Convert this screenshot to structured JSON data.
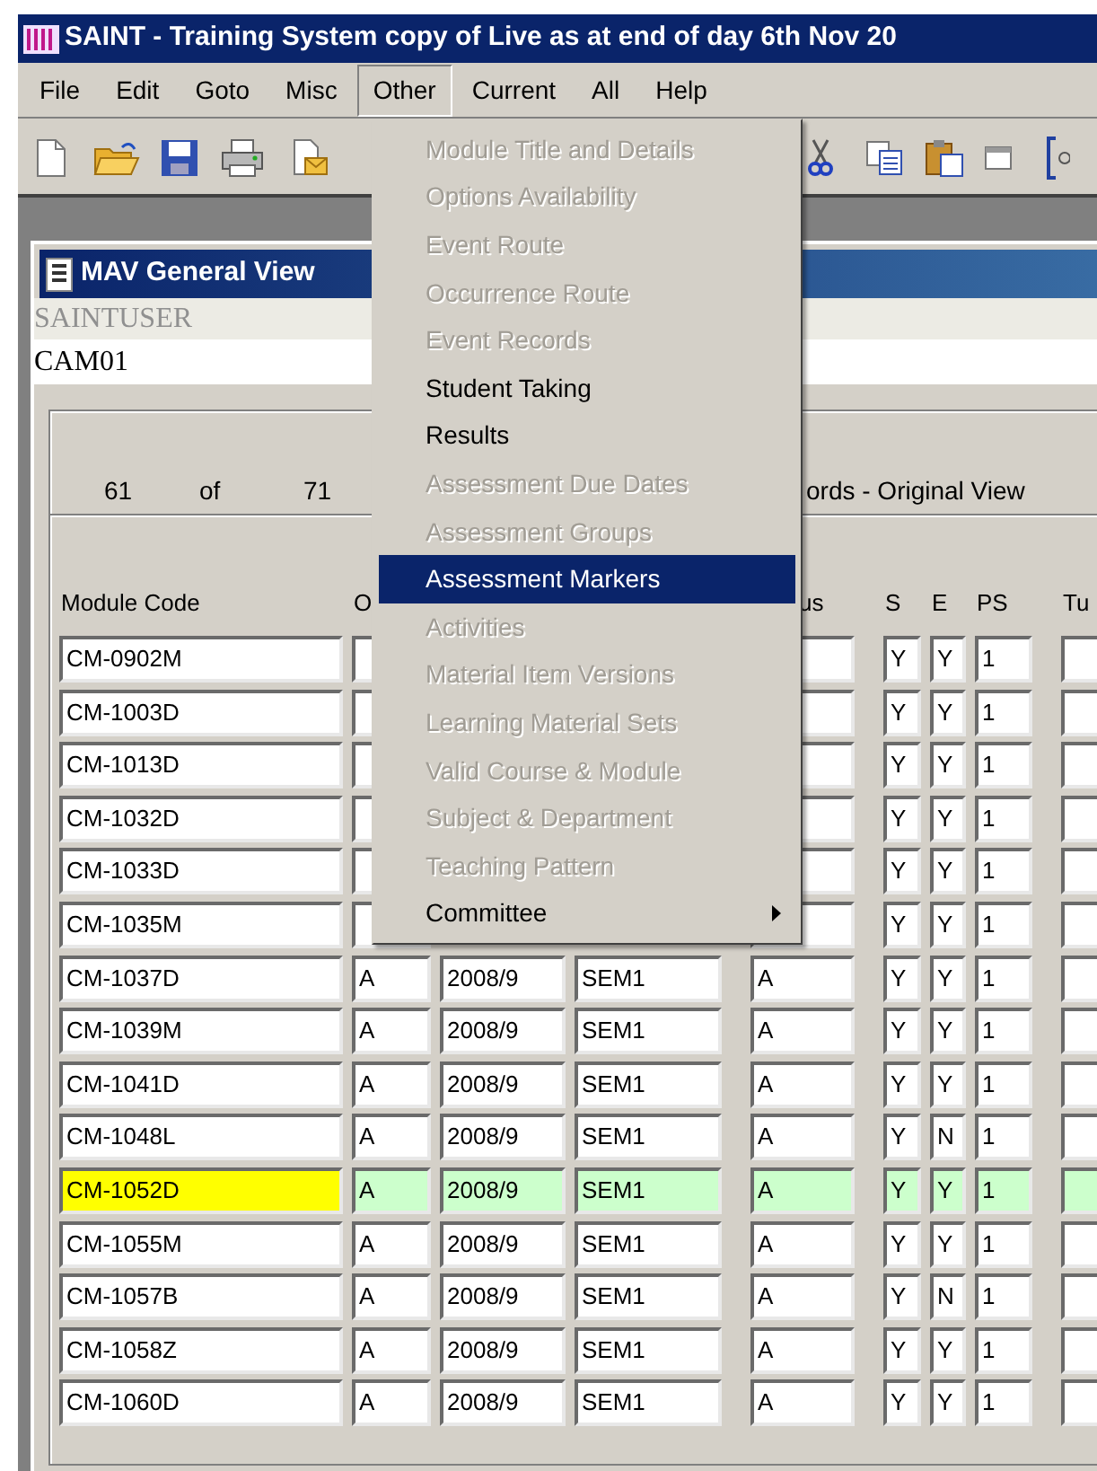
{
  "window": {
    "title": "SAINT - Training System copy of Live as at end of day 6th Nov 20"
  },
  "menu_bar": [
    {
      "label": "File",
      "selected": false
    },
    {
      "label": "Edit",
      "selected": false
    },
    {
      "label": "Goto",
      "selected": false
    },
    {
      "label": "Misc",
      "selected": false
    },
    {
      "label": "Other",
      "selected": true
    },
    {
      "label": "Current",
      "selected": false
    },
    {
      "label": "All",
      "selected": false
    },
    {
      "label": "Help",
      "selected": false
    }
  ],
  "other_menu": {
    "items": [
      {
        "label": "Module Title and Details",
        "disabled": true,
        "selected": false,
        "submenu": false
      },
      {
        "label": "Options Availability",
        "disabled": true,
        "selected": false,
        "submenu": false
      },
      {
        "label": "Event Route",
        "disabled": true,
        "selected": false,
        "submenu": false
      },
      {
        "label": "Occurrence Route",
        "disabled": true,
        "selected": false,
        "submenu": false
      },
      {
        "label": "Event Records",
        "disabled": true,
        "selected": false,
        "submenu": false
      },
      {
        "label": "Student Taking",
        "disabled": false,
        "selected": false,
        "submenu": false
      },
      {
        "label": "Results",
        "disabled": false,
        "selected": false,
        "submenu": false
      },
      {
        "label": "Assessment Due Dates",
        "disabled": true,
        "selected": false,
        "submenu": false
      },
      {
        "label": "Assessment Groups",
        "disabled": true,
        "selected": false,
        "submenu": false
      },
      {
        "label": "Assessment Markers",
        "disabled": false,
        "selected": true,
        "submenu": false
      },
      {
        "label": "Activities",
        "disabled": true,
        "selected": false,
        "submenu": false
      },
      {
        "label": "Material Item Versions",
        "disabled": true,
        "selected": false,
        "submenu": false
      },
      {
        "label": "Learning Material Sets",
        "disabled": true,
        "selected": false,
        "submenu": false
      },
      {
        "label": "Valid Course & Module",
        "disabled": true,
        "selected": false,
        "submenu": false
      },
      {
        "label": "Subject & Department",
        "disabled": true,
        "selected": false,
        "submenu": false
      },
      {
        "label": "Teaching Pattern",
        "disabled": true,
        "selected": false,
        "submenu": false
      },
      {
        "label": "Committee",
        "disabled": false,
        "selected": false,
        "submenu": true
      }
    ]
  },
  "child_window": {
    "title": "MAV General View",
    "user": "SAINTUSER",
    "code": "CAM01"
  },
  "record_counter": {
    "current": "61",
    "of_label": "of",
    "total": "71",
    "view_label": "ords - Original View"
  },
  "table": {
    "columns": [
      "Module Code",
      "O",
      "us",
      "S",
      "E",
      "PS",
      "Tu"
    ],
    "rows": [
      {
        "module_code": "CM-0902M",
        "s": "Y",
        "e": "Y",
        "ps": "1",
        "selected": false
      },
      {
        "module_code": "CM-1003D",
        "s": "Y",
        "e": "Y",
        "ps": "1",
        "selected": false
      },
      {
        "module_code": "CM-1013D",
        "s": "Y",
        "e": "Y",
        "ps": "1",
        "selected": false
      },
      {
        "module_code": "CM-1032D",
        "s": "Y",
        "e": "Y",
        "ps": "1",
        "selected": false
      },
      {
        "module_code": "CM-1033D",
        "s": "Y",
        "e": "Y",
        "ps": "1",
        "selected": false
      },
      {
        "module_code": "CM-1035M",
        "s": "Y",
        "e": "Y",
        "ps": "1",
        "selected": false
      },
      {
        "module_code": "CM-1037D",
        "o": "A",
        "year": "2008/9",
        "period": "SEM1",
        "status": "A",
        "s": "Y",
        "e": "Y",
        "ps": "1",
        "selected": false
      },
      {
        "module_code": "CM-1039M",
        "o": "A",
        "year": "2008/9",
        "period": "SEM1",
        "status": "A",
        "s": "Y",
        "e": "Y",
        "ps": "1",
        "selected": false
      },
      {
        "module_code": "CM-1041D",
        "o": "A",
        "year": "2008/9",
        "period": "SEM1",
        "status": "A",
        "s": "Y",
        "e": "Y",
        "ps": "1",
        "selected": false
      },
      {
        "module_code": "CM-1048L",
        "o": "A",
        "year": "2008/9",
        "period": "SEM1",
        "status": "A",
        "s": "Y",
        "e": "N",
        "ps": "1",
        "selected": false
      },
      {
        "module_code": "CM-1052D",
        "o": "A",
        "year": "2008/9",
        "period": "SEM1",
        "status": "A",
        "s": "Y",
        "e": "Y",
        "ps": "1",
        "selected": true
      },
      {
        "module_code": "CM-1055M",
        "o": "A",
        "year": "2008/9",
        "period": "SEM1",
        "status": "A",
        "s": "Y",
        "e": "Y",
        "ps": "1",
        "selected": false
      },
      {
        "module_code": "CM-1057B",
        "o": "A",
        "year": "2008/9",
        "period": "SEM1",
        "status": "A",
        "s": "Y",
        "e": "N",
        "ps": "1",
        "selected": false
      },
      {
        "module_code": "CM-1058Z",
        "o": "A",
        "year": "2008/9",
        "period": "SEM1",
        "status": "A",
        "s": "Y",
        "e": "Y",
        "ps": "1",
        "selected": false
      },
      {
        "module_code": "CM-1060D",
        "o": "A",
        "year": "2008/9",
        "period": "SEM1",
        "status": "A",
        "s": "Y",
        "e": "Y",
        "ps": "1",
        "selected": false
      }
    ]
  }
}
